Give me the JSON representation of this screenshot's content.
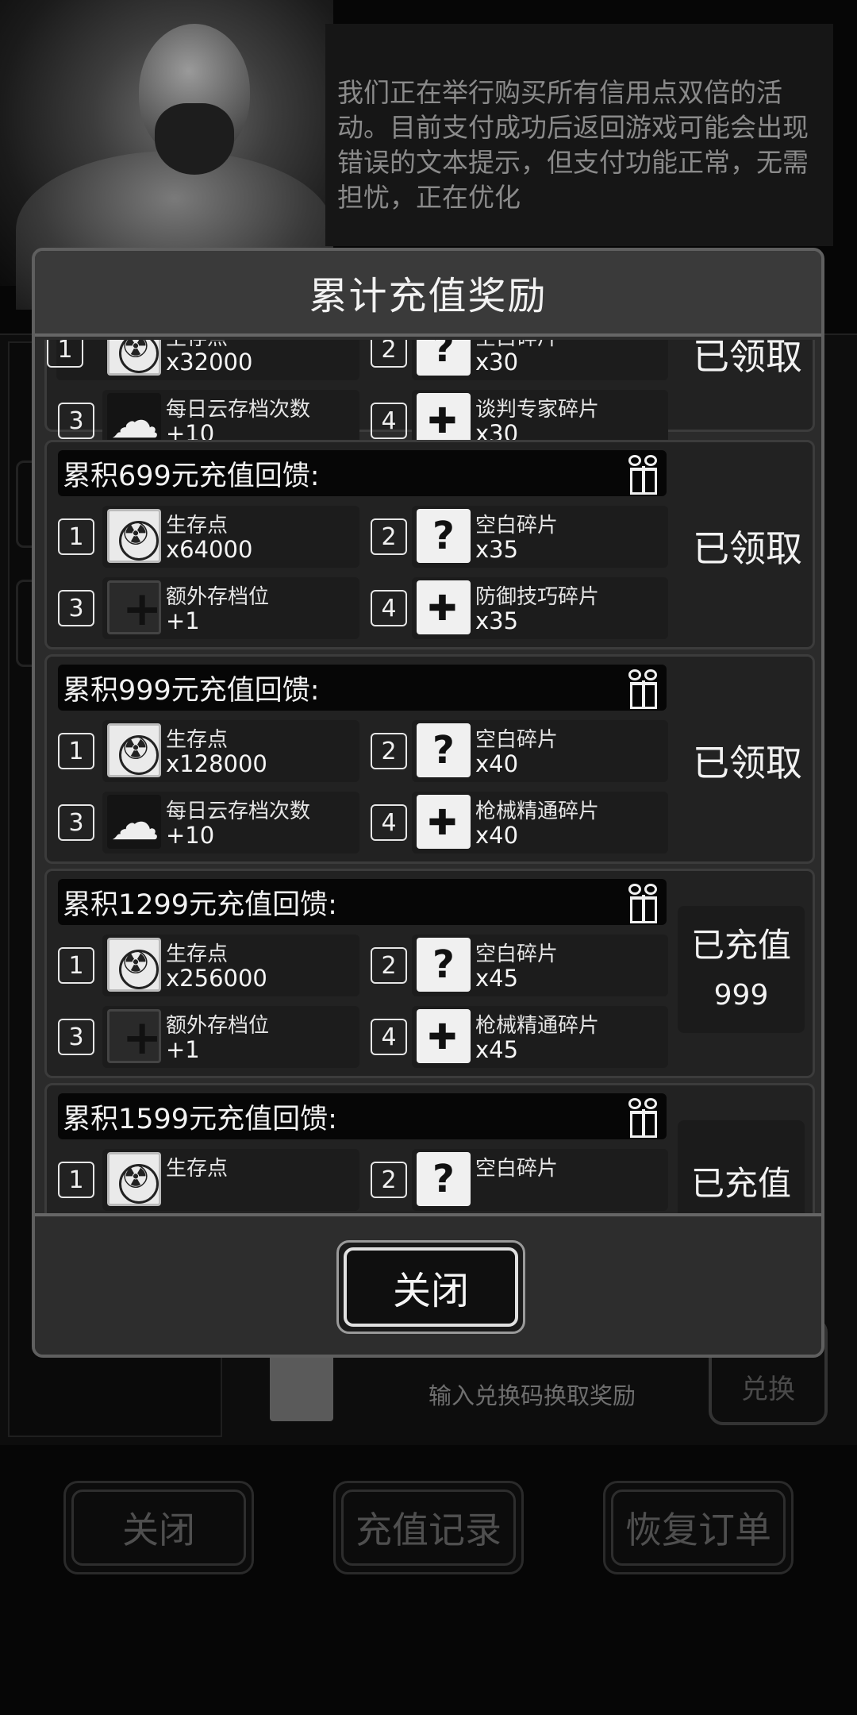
{
  "background": {
    "notice": "我们正在举行购买所有信用点双倍的活动。目前支付成功后返回游戏可能会出现错误的文本提示，但支付功能正常，无需担忧，正在优化",
    "redeem_hint": "输入兑换码换取奖励",
    "redeem_button": "兑换",
    "bottom_buttons": [
      "关闭",
      "充值记录",
      "恢复订单"
    ]
  },
  "modal": {
    "title": "累计充值奖励",
    "close_label": "关闭",
    "tiers": [
      {
        "title": "",
        "status": "已领取",
        "rewards": [
          {
            "num": "1",
            "icon": "radiation-icon",
            "name": "生存点",
            "amount": "x32000"
          },
          {
            "num": "2",
            "icon": "puzzle-question-icon",
            "name": "空白碎片",
            "amount": "x30"
          },
          {
            "num": "3",
            "icon": "cloud-save-icon",
            "name": "每日云存档次数",
            "amount": "+10"
          },
          {
            "num": "4",
            "icon": "handshake-puzzle-icon",
            "name": "谈判专家碎片",
            "amount": "x30"
          }
        ]
      },
      {
        "title": "累积699元充值回馈:",
        "status": "已领取",
        "rewards": [
          {
            "num": "1",
            "icon": "radiation-icon",
            "name": "生存点",
            "amount": "x64000"
          },
          {
            "num": "2",
            "icon": "puzzle-question-icon",
            "name": "空白碎片",
            "amount": "x35"
          },
          {
            "num": "3",
            "icon": "extra-slot-icon",
            "name": "额外存档位",
            "amount": "+1"
          },
          {
            "num": "4",
            "icon": "shield-puzzle-icon",
            "name": "防御技巧碎片",
            "amount": "x35"
          }
        ]
      },
      {
        "title": "累积999元充值回馈:",
        "status": "已领取",
        "rewards": [
          {
            "num": "1",
            "icon": "radiation-icon",
            "name": "生存点",
            "amount": "x128000"
          },
          {
            "num": "2",
            "icon": "puzzle-question-icon",
            "name": "空白碎片",
            "amount": "x40"
          },
          {
            "num": "3",
            "icon": "cloud-save-icon",
            "name": "每日云存档次数",
            "amount": "+10"
          },
          {
            "num": "4",
            "icon": "gun-puzzle-icon",
            "name": "枪械精通碎片",
            "amount": "x40"
          }
        ]
      },
      {
        "title": "累积1299元充值回馈:",
        "status_l1": "已充值",
        "status_l2": "999",
        "rewards": [
          {
            "num": "1",
            "icon": "radiation-icon",
            "name": "生存点",
            "amount": "x256000"
          },
          {
            "num": "2",
            "icon": "puzzle-question-icon",
            "name": "空白碎片",
            "amount": "x45"
          },
          {
            "num": "3",
            "icon": "extra-slot-icon",
            "name": "额外存档位",
            "amount": "+1"
          },
          {
            "num": "4",
            "icon": "gun-puzzle-icon",
            "name": "枪械精通碎片",
            "amount": "x45"
          }
        ]
      },
      {
        "title": "累积1599元充值回馈:",
        "status_l1": "已充值",
        "rewards": [
          {
            "num": "1",
            "icon": "radiation-icon",
            "name": "生存点",
            "amount": ""
          },
          {
            "num": "2",
            "icon": "puzzle-question-icon",
            "name": "空白碎片",
            "amount": ""
          }
        ]
      }
    ]
  }
}
